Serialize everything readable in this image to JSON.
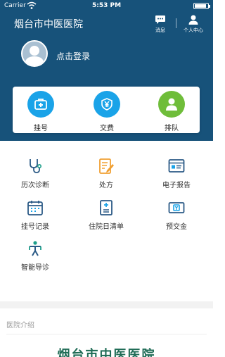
{
  "status_bar": {
    "carrier": "Carrier",
    "time": "5:53 PM",
    "battery_level": 0.9
  },
  "header": {
    "title": "烟台市中医医院",
    "actions": [
      {
        "label": "消息",
        "icon": "message-icon"
      },
      {
        "label": "个人中心",
        "icon": "user-icon"
      }
    ],
    "login_label": "点击登录"
  },
  "quick_actions": [
    {
      "label": "挂号",
      "icon": "medical-kit-icon",
      "color": "#1aa3e8"
    },
    {
      "label": "交费",
      "icon": "yuan-shield-icon",
      "color": "#1aa3e8"
    },
    {
      "label": "排队",
      "icon": "person-icon",
      "color": "#6fbd3a"
    }
  ],
  "grid": [
    {
      "label": "历次诊断",
      "icon": "stethoscope-icon"
    },
    {
      "label": "处方",
      "icon": "prescription-icon"
    },
    {
      "label": "电子报告",
      "icon": "report-icon"
    },
    {
      "label": "挂号记录",
      "icon": "calendar-icon"
    },
    {
      "label": "住院日清单",
      "icon": "hospital-list-icon"
    },
    {
      "label": "预交金",
      "icon": "money-icon"
    },
    {
      "label": "智能导诊",
      "icon": "guide-person-icon"
    }
  ],
  "intro": {
    "label": "医院介绍",
    "banner_text": "烟台市中医医院"
  },
  "colors": {
    "header_bg": "#17527a",
    "accent_blue": "#1aa3e8",
    "accent_green": "#6fbd3a",
    "icon_navy": "#2b5a86",
    "icon_orange": "#f0a033"
  }
}
